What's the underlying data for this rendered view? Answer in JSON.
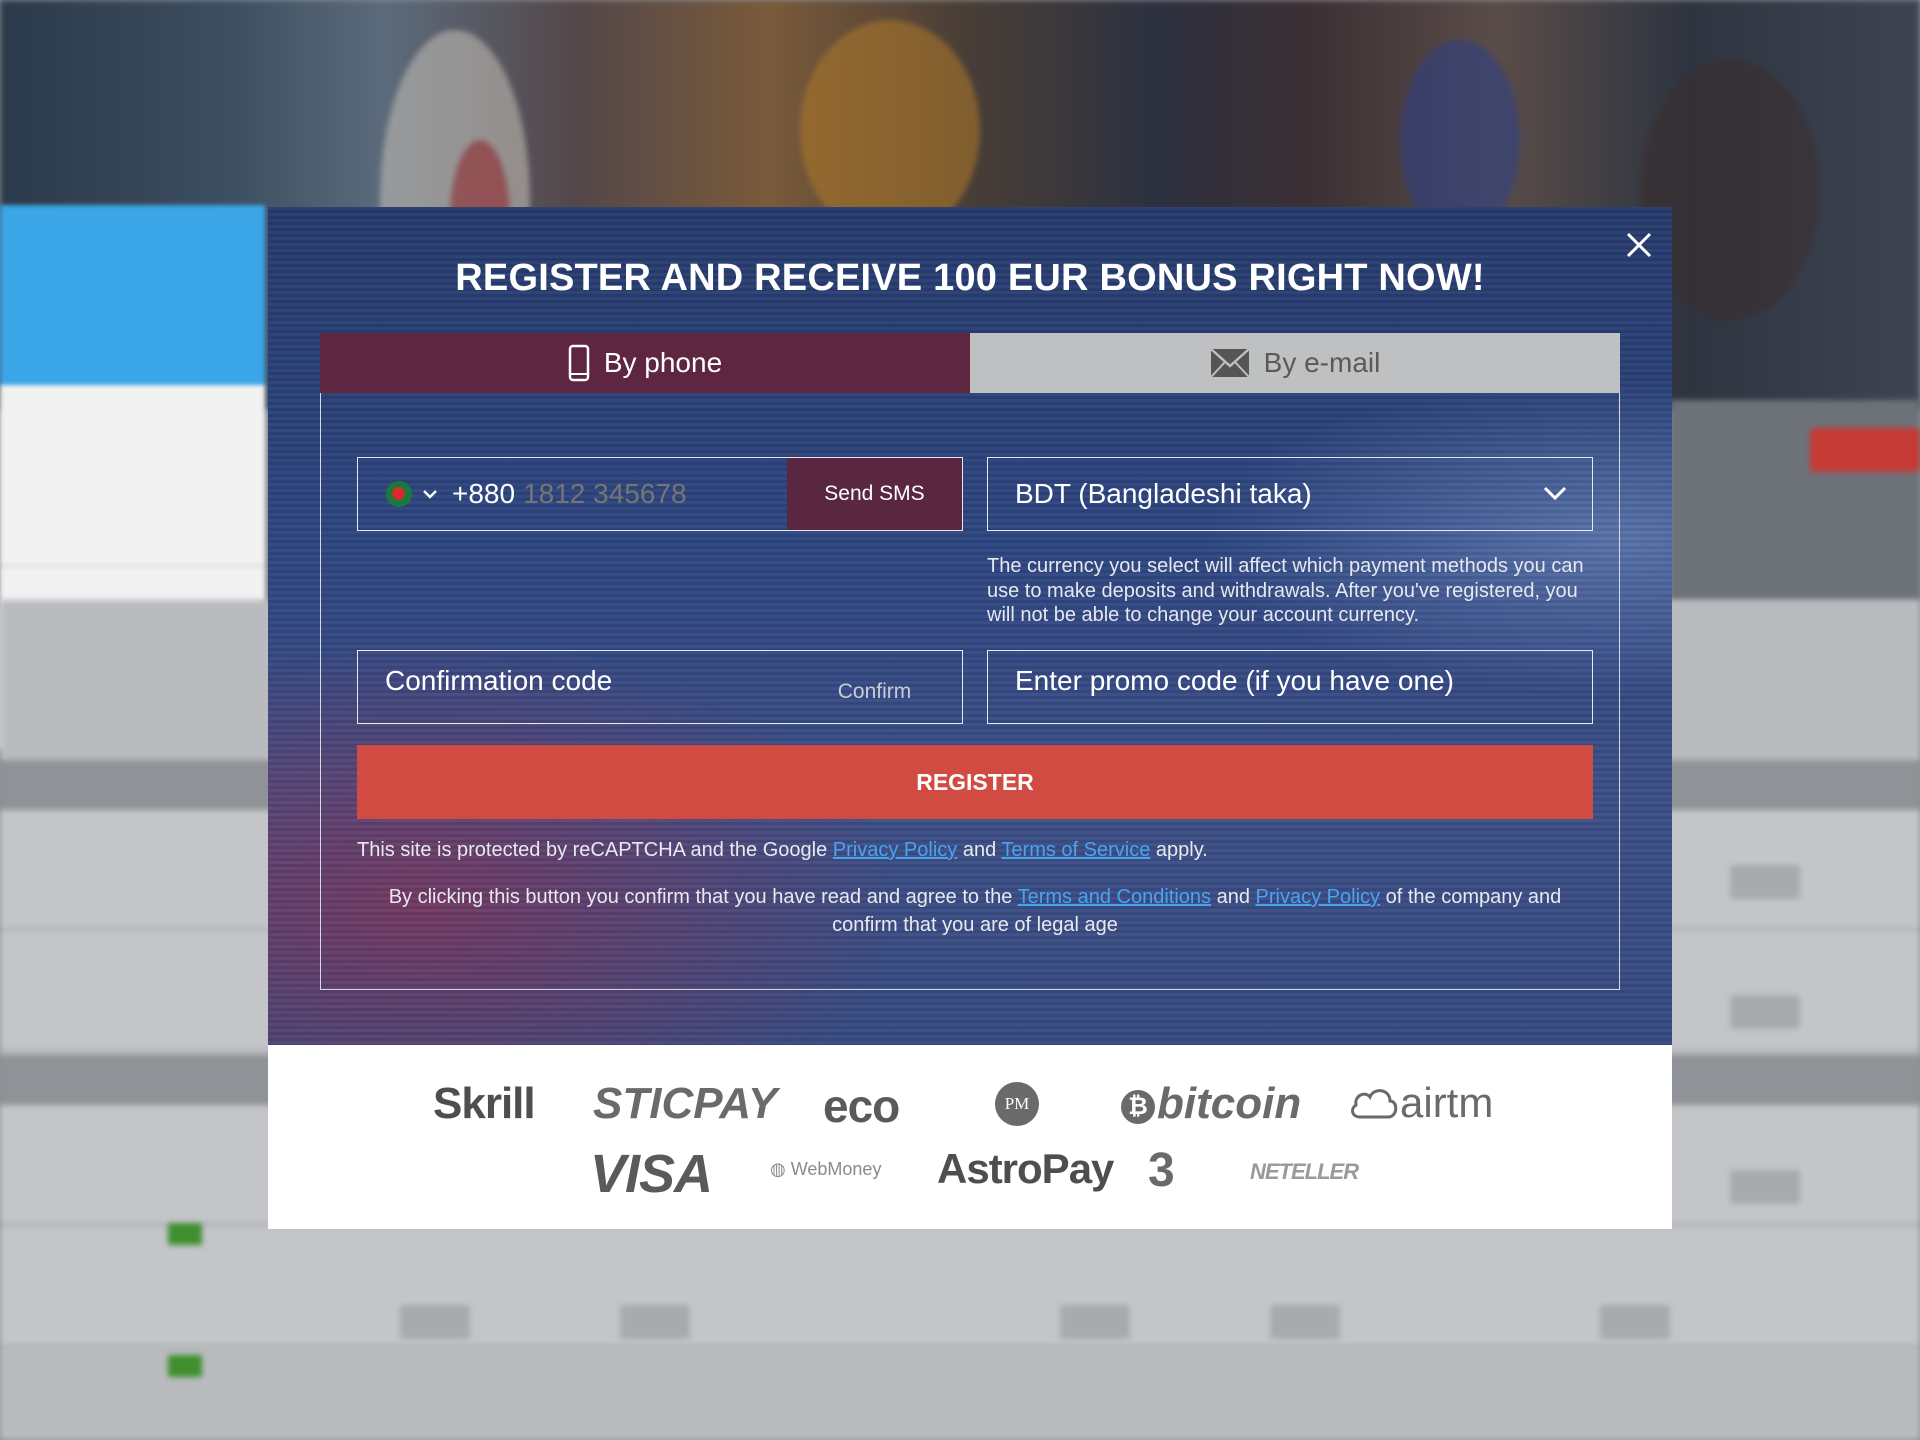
{
  "modal": {
    "title": "REGISTER AND RECEIVE 100 EUR BONUS RIGHT NOW!",
    "tabs": [
      {
        "label": "By phone",
        "icon": "phone-icon",
        "active": true
      },
      {
        "label": "By e-mail",
        "icon": "envelope-icon",
        "active": false
      }
    ],
    "phone": {
      "country_flag": "bangladesh-flag-icon",
      "prefix": "+880",
      "placeholder": "1812 345678",
      "send_sms_label": "Send SMS"
    },
    "currency": {
      "selected": "BDT (Bangladeshi taka)",
      "note": "The currency you select will affect which payment methods you can use to make deposits and withdrawals. After you've registered, you will not be able to change your account currency."
    },
    "confirmation": {
      "placeholder": "Confirmation code",
      "confirm_label": "Confirm"
    },
    "promo": {
      "placeholder": "Enter promo code (if you have one)"
    },
    "register_label": "REGISTER",
    "recaptcha": {
      "prefix": "This site is protected by reCAPTCHA and the Google",
      "privacy_link": "Privacy Policy",
      "and": "and",
      "terms_link": "Terms of Service",
      "suffix": "apply."
    },
    "agreement": {
      "prefix": "By clicking this button you confirm that you have read and agree to the",
      "terms_link": "Terms and Conditions",
      "and": "and",
      "privacy_link": "Privacy Policy",
      "suffix": "of the company and confirm that you are of legal age"
    }
  },
  "payments": {
    "row1": [
      "Skrill",
      "STICPAY",
      "eco",
      "PM",
      "bitcoin",
      "airtm"
    ],
    "row2": [
      "VISA",
      "WebMoney",
      "AstroPay",
      "3",
      "NETELLER"
    ]
  },
  "colors": {
    "active_tab": "#5e2640",
    "inactive_tab": "#bfc0c2",
    "register_button": "#d24b43",
    "link": "#4aa3f0"
  }
}
